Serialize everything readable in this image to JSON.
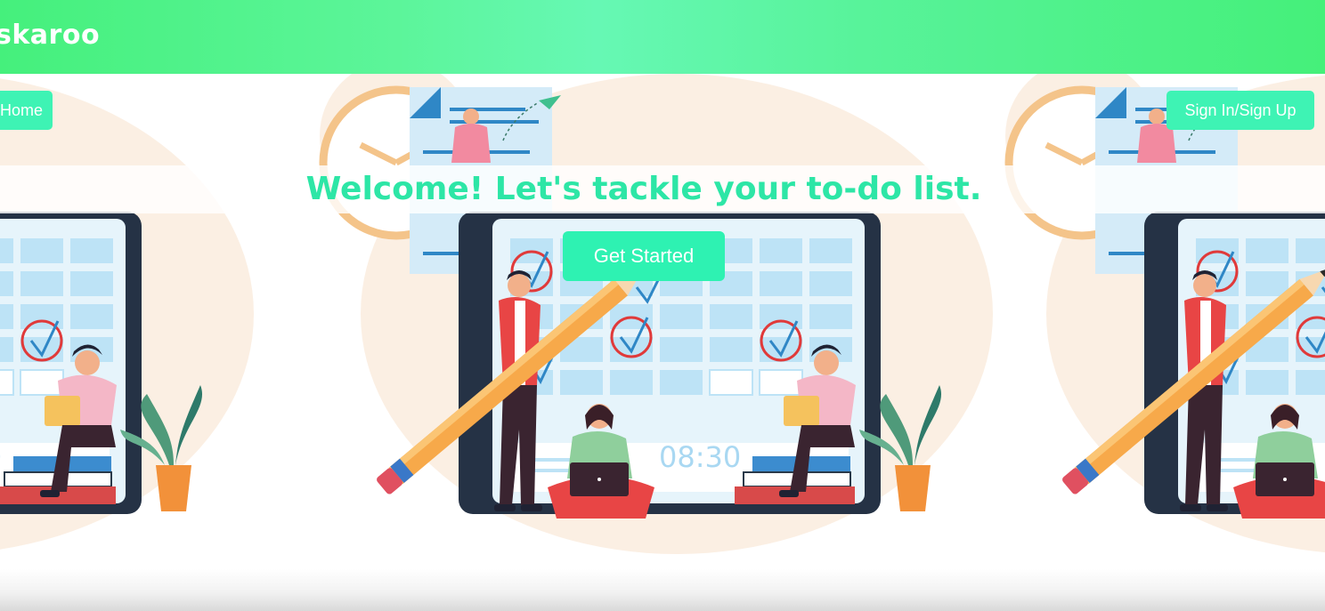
{
  "header": {
    "brand": "skaroo"
  },
  "nav": {
    "home_label": "Home",
    "signin_label": "Sign In/Sign Up"
  },
  "hero": {
    "headline": "Welcome! Let's tackle your to-do list.",
    "cta_label": "Get Started",
    "clock_time": "08:30"
  },
  "colors": {
    "header_green": "#45f07c",
    "accent_teal": "#2de6a6",
    "button_teal": "#3ef3b4"
  }
}
